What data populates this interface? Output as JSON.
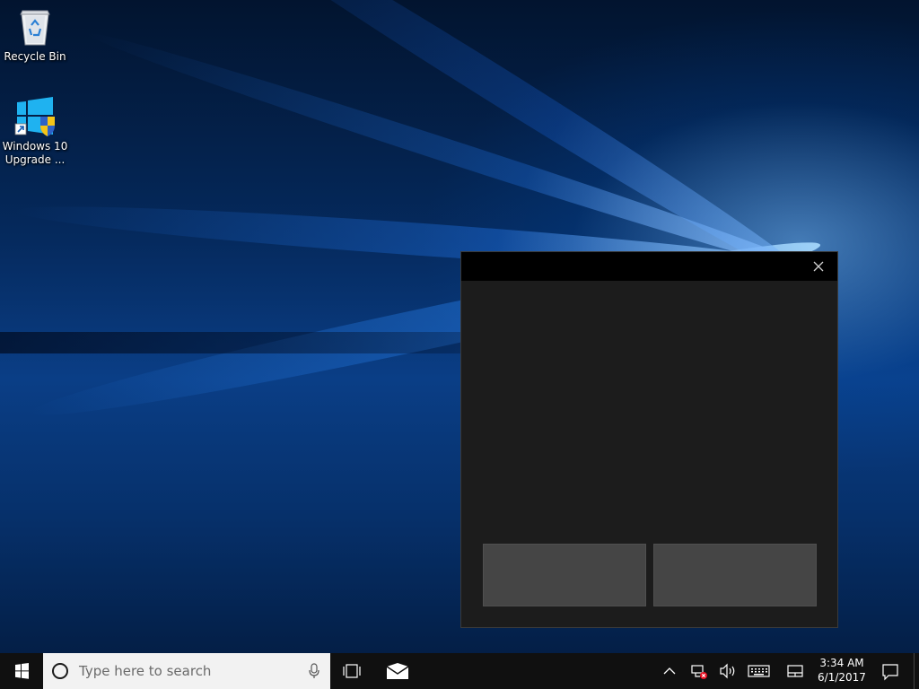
{
  "desktop": {
    "icons": [
      {
        "label": "Recycle Bin",
        "icon": "recycle-bin-icon"
      },
      {
        "label": "Windows 10 Upgrade ...",
        "icon": "windows-logo-shortcut-icon"
      }
    ]
  },
  "dialog": {
    "close_icon": "close-icon",
    "left_button_label": "",
    "right_button_label": ""
  },
  "taskbar": {
    "start_icon": "windows-start-icon",
    "search": {
      "placeholder": "Type here to search",
      "cortana_icon": "cortana-circle-icon",
      "mic_icon": "microphone-icon"
    },
    "task_view_icon": "task-view-icon",
    "pinned": [
      {
        "name": "mail",
        "icon": "mail-envelope-icon"
      }
    ],
    "tray": {
      "icons": [
        "chevron-up-icon",
        "network-disconnected-icon",
        "volume-icon",
        "touch-keyboard-icon",
        "touchpad-icon"
      ]
    },
    "clock": {
      "time": "3:34 AM",
      "date": "6/1/2017"
    },
    "action_center_icon": "action-center-icon"
  },
  "colors": {
    "taskbar_bg": "#101010",
    "dialog_bg": "#1c1c1c",
    "dialog_titlebar": "#000000",
    "dialog_button": "#454545",
    "search_bg": "#f2f2f2"
  }
}
